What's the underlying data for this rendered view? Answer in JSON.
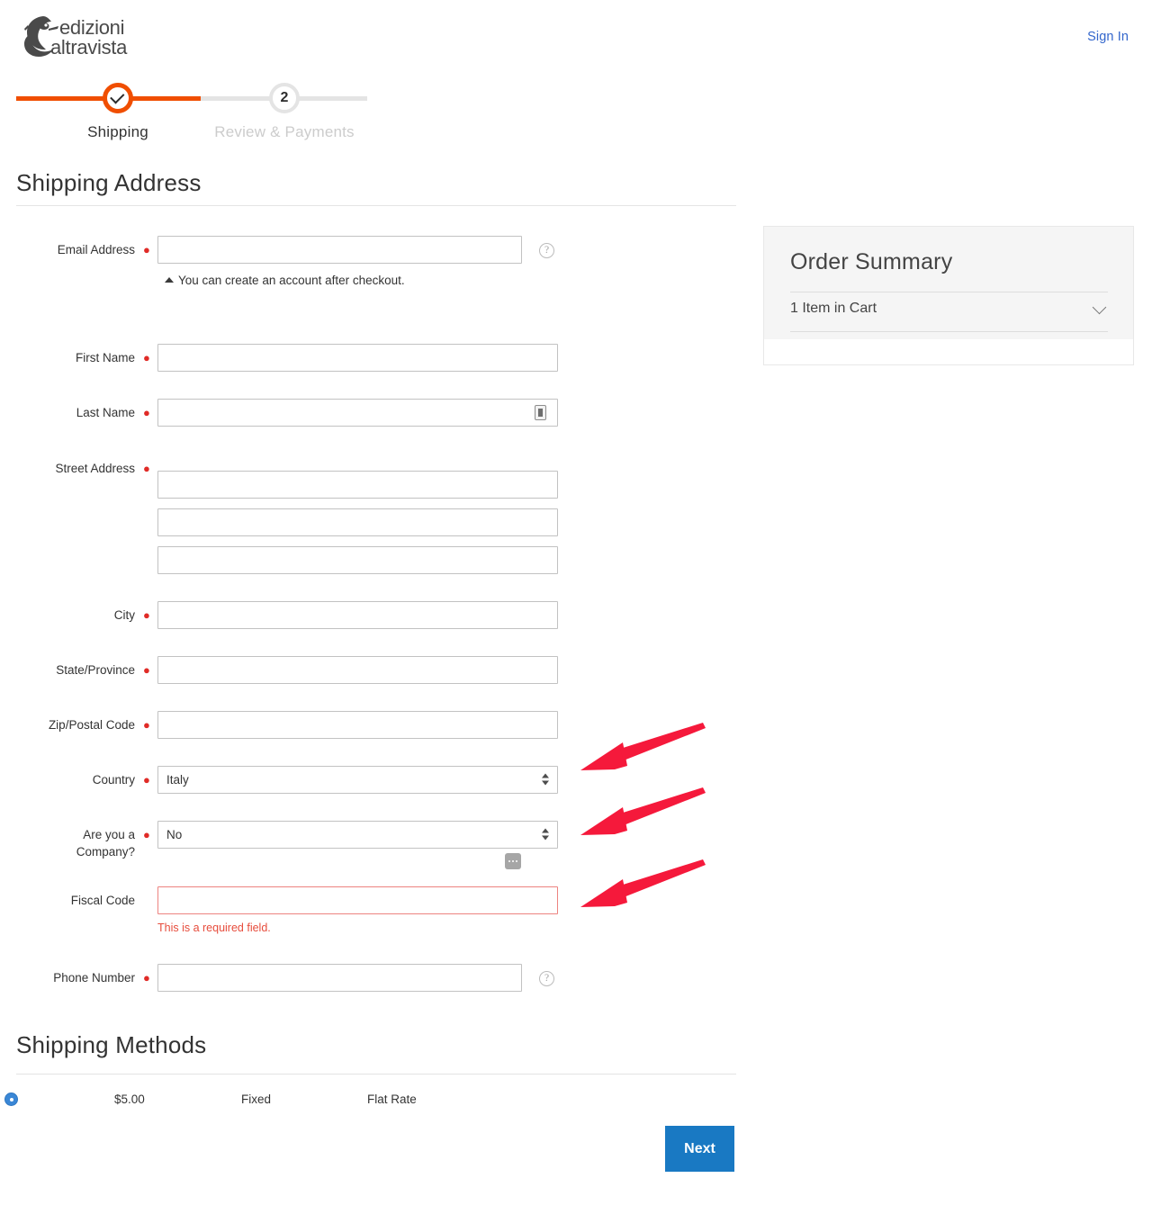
{
  "header": {
    "logo_line1": "edizioni",
    "logo_line2": "altravista",
    "sign_in": "Sign In"
  },
  "progress": {
    "steps": [
      {
        "label": "Shipping",
        "marker": "check",
        "state": "complete"
      },
      {
        "label": "Review & Payments",
        "marker": "2",
        "state": "upcoming"
      }
    ],
    "active_color": "#f04e00",
    "inactive_color": "#e4e4e4"
  },
  "shipping_address": {
    "title": "Shipping Address",
    "fields": {
      "email_label": "Email Address",
      "email_value": "",
      "email_note": "You can create an account after checkout.",
      "first_name_label": "First Name",
      "first_name_value": "",
      "last_name_label": "Last Name",
      "last_name_value": "",
      "street_label": "Street Address",
      "street_value_1": "",
      "street_value_2": "",
      "street_value_3": "",
      "city_label": "City",
      "city_value": "",
      "state_label": "State/Province",
      "state_value": "",
      "zip_label": "Zip/Postal Code",
      "zip_value": "",
      "country_label": "Country",
      "country_value": "Italy",
      "company_label_line1": "Are you a",
      "company_label_line2": "Company?",
      "company_value": "No",
      "fiscal_label": "Fiscal Code",
      "fiscal_value": "",
      "fiscal_error": "This is a required field.",
      "phone_label": "Phone Number",
      "phone_value": ""
    }
  },
  "order_summary": {
    "title": "Order Summary",
    "cart_row": "1 Item in Cart"
  },
  "shipping_methods": {
    "title": "Shipping Methods",
    "rows": [
      {
        "selected": true,
        "price": "$5.00",
        "method": "Fixed",
        "carrier": "Flat Rate"
      }
    ]
  },
  "actions": {
    "next_label": "Next",
    "next_color": "#1979c3"
  },
  "annotations": {
    "arrow_color": "#f5193b",
    "arrows": [
      {
        "target": "country-select"
      },
      {
        "target": "company-select"
      },
      {
        "target": "fiscal-code-input"
      }
    ]
  }
}
